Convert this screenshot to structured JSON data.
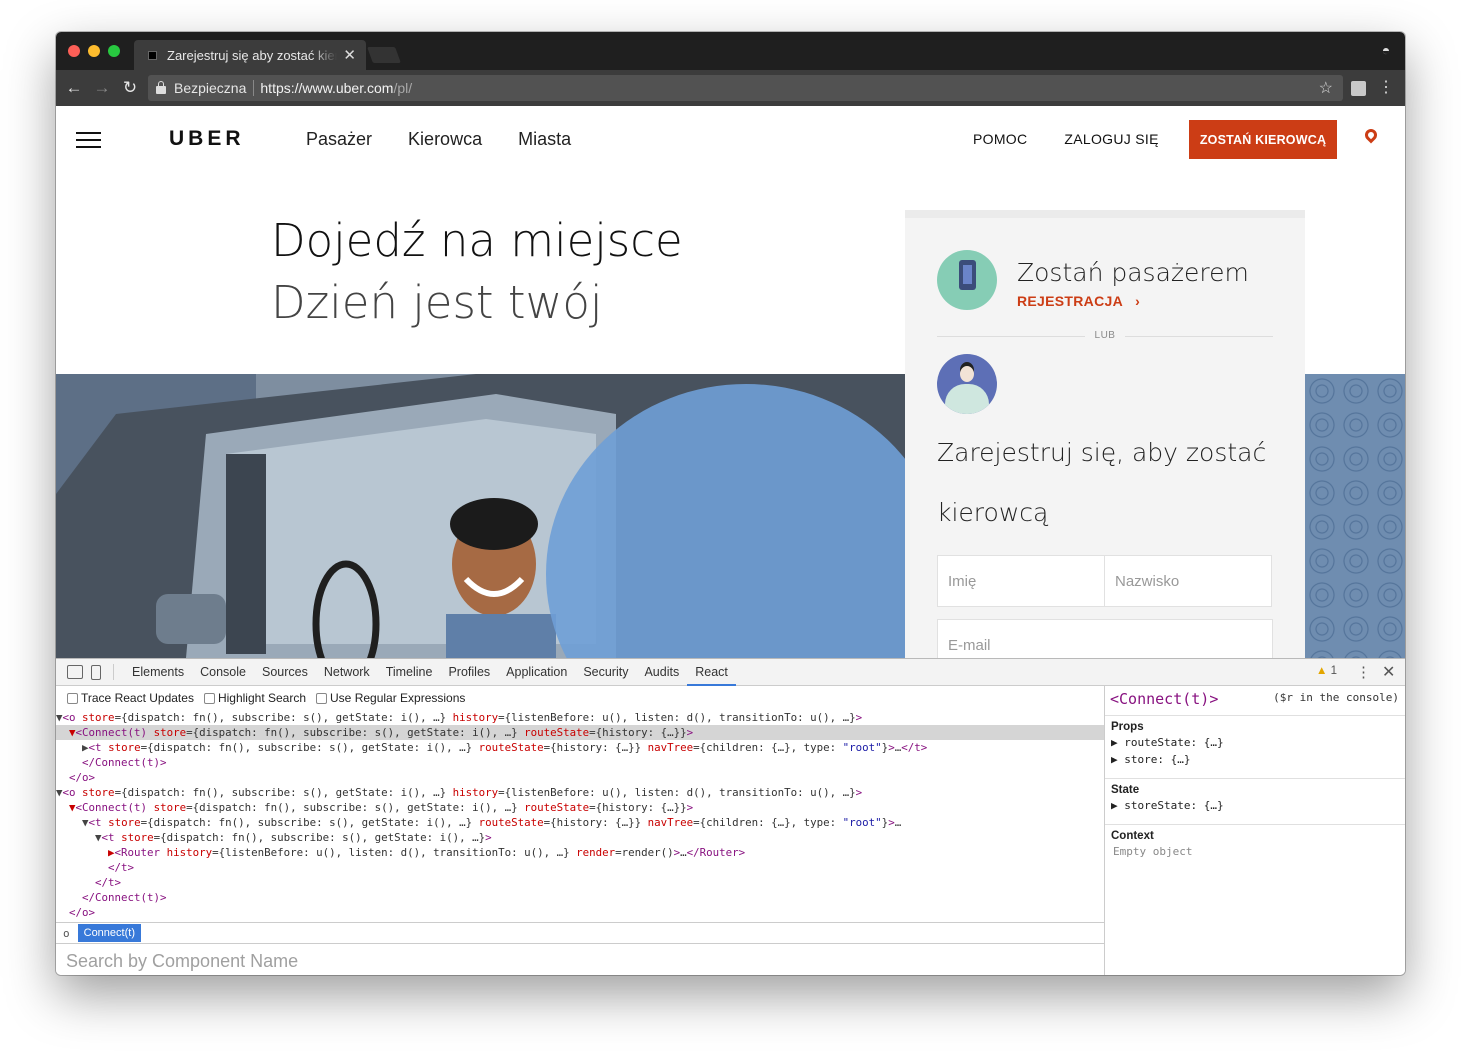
{
  "browser": {
    "tab_title": "Zarejestruj się aby zostać kierowcą",
    "tab_close": "✕",
    "secure_label": "Bezpieczna",
    "url_main": "https://www.uber.com",
    "url_path": "/pl/"
  },
  "site": {
    "logo": "UBER",
    "nav": [
      "Pasażer",
      "Kierowca",
      "Miasta"
    ],
    "right_nav": [
      "POMOC",
      "ZALOGUJ SIĘ"
    ],
    "cta": "ZOSTAŃ KIEROWCĄ",
    "accent_color": "#cc3d15"
  },
  "hero": {
    "title": "Dojedź na miejsce",
    "subtitle": "Dzień jest twój"
  },
  "signup": {
    "rider_title": "Zostań pasażerem",
    "rider_link": "REJESTRACJA",
    "rider_link_arrow": "›",
    "or": "LUB",
    "driver_title": "Zarejestruj się, aby zostać kierowcą",
    "first_name_placeholder": "Imię",
    "last_name_placeholder": "Nazwisko",
    "email_placeholder": "E-mail"
  },
  "devtools": {
    "tabs": [
      "Elements",
      "Console",
      "Sources",
      "Network",
      "Timeline",
      "Profiles",
      "Application",
      "Security",
      "Audits",
      "React"
    ],
    "active_tab": "React",
    "warning_count": "1",
    "options": [
      "Trace React Updates",
      "Highlight Search",
      "Use Regular Expressions"
    ],
    "breadcrumb_dot": "o",
    "breadcrumb_selected": "Connect(t)",
    "search_placeholder": "Search by Component Name",
    "selected_component": "<Connect(t)>",
    "console_hint": "($r in the console)",
    "props_title": "Props",
    "props": [
      "routeState: {…}",
      "store: {…}"
    ],
    "state_title": "State",
    "state": [
      "storeState: {…}"
    ],
    "context_title": "Context",
    "context_empty": "Empty object"
  }
}
